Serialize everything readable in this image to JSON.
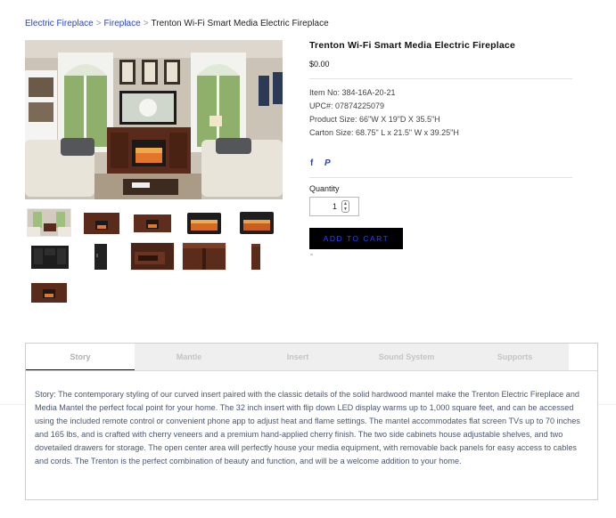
{
  "breadcrumb": {
    "items": [
      "Electric Fireplace",
      "Fireplace"
    ],
    "separator": ">",
    "current": "Trenton Wi-Fi Smart Media Electric Fireplace"
  },
  "product": {
    "title": "Trenton Wi-Fi Smart Media Electric Fireplace",
    "price": "$0.00",
    "specs": [
      "Item No: 384-16A-20-21",
      "UPC#: 07874225079",
      "Product Size: 66\"W X 19\"D X 35.5\"H",
      "Carton Size: 68.75\" L x 21.5\" W x 39.25\"H"
    ],
    "share": {
      "facebook": "f",
      "pinterest": "P"
    },
    "quantity_label": "Quantity",
    "quantity_value": "1",
    "add_to_cart": "ADD TO CART"
  },
  "gallery": {
    "main_image": "living-room-fireplace-photo",
    "thumbnails": [
      "room-scene",
      "fireplace-front",
      "fireplace-angle",
      "insert-front",
      "insert-angle",
      "media-back-panel",
      "side-view",
      "drawer-detail",
      "corner-detail",
      "side-profile",
      "fireplace-small"
    ]
  },
  "tabs": {
    "labels": [
      "Story",
      "Mantle",
      "Insert",
      "Sound System",
      "Supports"
    ],
    "active": "Story",
    "story_text": "Story: The contemporary styling of our curved insert paired with the classic details of the solid hardwood mantel make the Trenton Electric Fireplace and Media Mantel the perfect focal point for your home. The 32 inch insert with flip down LED display warms up to 1,000 square feet, and can be accessed using the included remote control or convenient phone app to adjust heat and flame settings. The mantel accommodates flat screen TVs up to 70 inches and 165 lbs, and is crafted with cherry veneers and a premium hand-applied cherry finish. The two side cabinets house adjustable shelves, and two dovetailed drawers for storage. The open center area will perfectly house your media equipment, with removable back panels for easy access to cables and cords. The Trenton is the perfect combination of beauty and function, and will be a welcome addition to your home."
  },
  "colors": {
    "link": "#2a44c9",
    "button_bg": "#000000",
    "button_text": "#2a44ff",
    "wood": "#5a2a1a"
  }
}
